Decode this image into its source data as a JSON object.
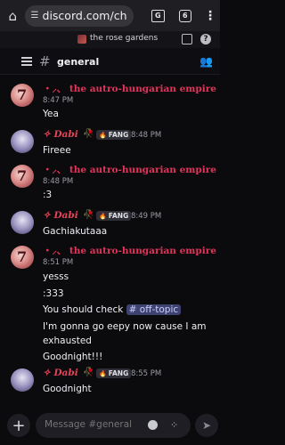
{
  "browser": {
    "url": "discord.com/chann",
    "tab_count": "6"
  },
  "server": {
    "name": "the rose gardens"
  },
  "channel": {
    "name": "general"
  },
  "users": {
    "empire": "・⸝、 the autro-hungarian empire",
    "dabi": "✧ Dabi",
    "fang_tag": "FANG"
  },
  "messages": [
    {
      "author": "empire",
      "time": "8:47 PM",
      "lines": [
        "Yea"
      ]
    },
    {
      "author": "dabi",
      "time": "8:48 PM",
      "lines": [
        "Fireee"
      ]
    },
    {
      "author": "empire",
      "time": "8:48 PM",
      "lines": [
        ":3"
      ]
    },
    {
      "author": "dabi",
      "time": "8:49 PM",
      "lines": [
        "Gachiakutaaa"
      ]
    },
    {
      "author": "empire",
      "time": "8:51 PM",
      "lines": [
        "yesss",
        ":333",
        "You should check",
        "I'm gonna go eepy now cause I am",
        "exhausted",
        "Goodnight!!!"
      ],
      "mention": "# off-topic"
    },
    {
      "author": "dabi",
      "time": "8:55 PM",
      "lines": [
        "Goodnight"
      ]
    }
  ],
  "composer": {
    "placeholder": "Message #general"
  },
  "colors": {
    "background": "#0b0b0e",
    "empire_name": "#e2345a",
    "dabi_name": "#e6455a",
    "mention_bg": "#3d4270"
  }
}
